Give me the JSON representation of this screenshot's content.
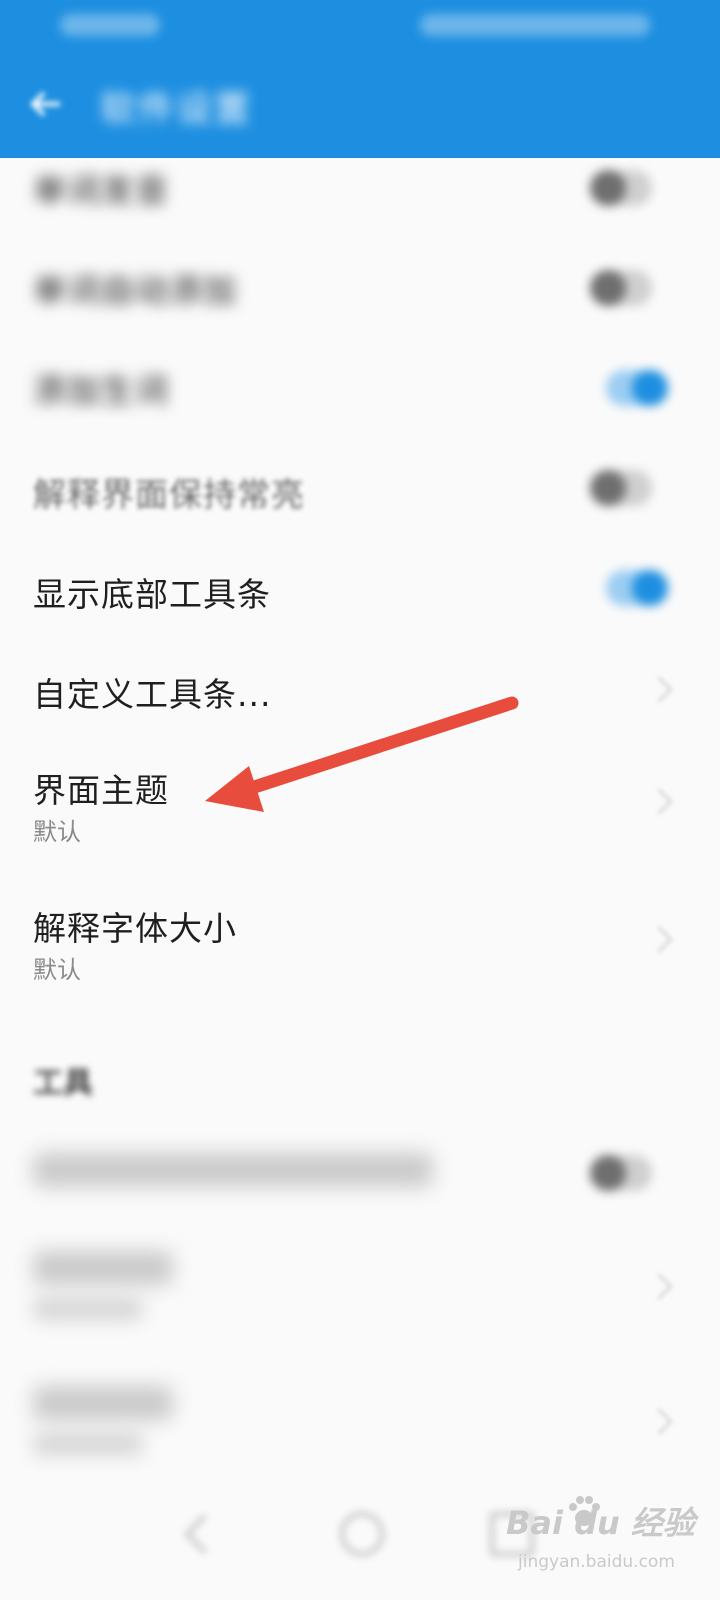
{
  "appbar": {
    "title": "软件设置"
  },
  "settings": {
    "item_1": {
      "title": "单词发音"
    },
    "item_2": {
      "title": "单词自动添加"
    },
    "item_3": {
      "title": "添加生词"
    },
    "keep_screen_on": {
      "title": "解释界面保持常亮"
    },
    "show_bottom_toolbar": {
      "title": "显示底部工具条"
    },
    "custom_toolbar": {
      "title": "自定义工具条..."
    },
    "theme": {
      "title": "界面主题",
      "value": "默认"
    },
    "font_size": {
      "title": "解释字体大小",
      "value": "默认"
    }
  },
  "tools_section": {
    "header": "工具",
    "item_1": {
      "title": ""
    },
    "item_2": {
      "title": ""
    },
    "item_3": {
      "title": ""
    }
  },
  "watermark": {
    "logo": "Bai du 经验",
    "sub": "jingyan.baidu.com"
  },
  "colors": {
    "primary": "#1e8fe0",
    "annotation_arrow": "#e74c3c"
  },
  "icons": {
    "back": "arrow-left-icon",
    "toggle": "switch-icon",
    "chevron": "chevron-right-icon",
    "nav_back": "triangle-back-icon",
    "nav_home": "circle-home-icon",
    "nav_recent": "square-recent-icon"
  }
}
